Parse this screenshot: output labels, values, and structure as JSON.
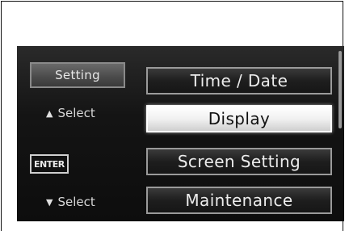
{
  "panel": {
    "setting_label": "Setting",
    "select_up_label": "Select",
    "enter_label": "ENTER",
    "select_down_label": "Select"
  },
  "menu": {
    "items": [
      {
        "label": "Time / Date",
        "selected": false
      },
      {
        "label": "Display",
        "selected": true
      },
      {
        "label": "Screen Setting",
        "selected": false
      },
      {
        "label": "Maintenance",
        "selected": false
      }
    ]
  },
  "icons": {
    "up": "triangle-up-icon",
    "down": "triangle-down-icon"
  }
}
